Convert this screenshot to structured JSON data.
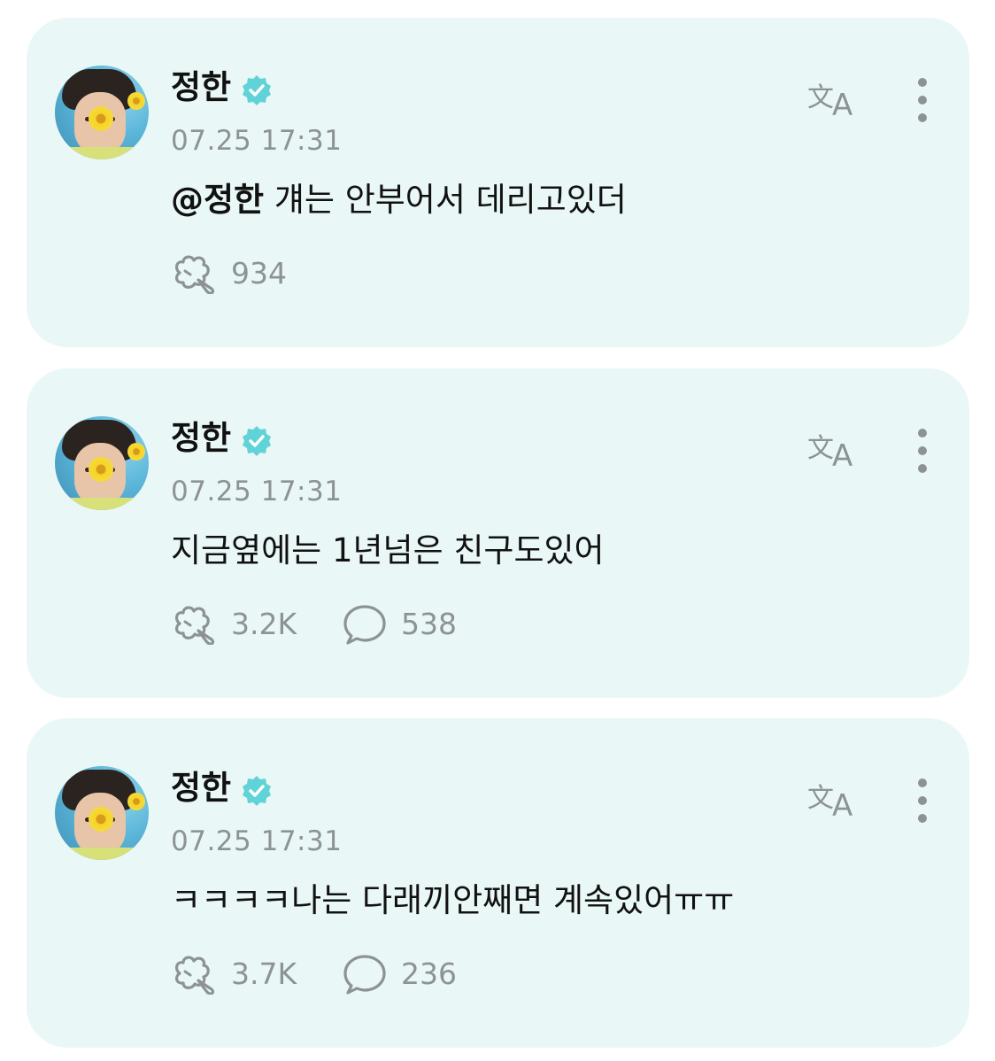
{
  "posts": [
    {
      "author": "정한",
      "timestamp": "07.25 17:31",
      "mention": "@정한",
      "text": " 걔는 안부어서 데리고있더",
      "likes": "934",
      "comments": ""
    },
    {
      "author": "정한",
      "timestamp": "07.25 17:31",
      "mention": "",
      "text": "지금옆에는 1년넘은 친구도있어",
      "likes": "3.2K",
      "comments": "538"
    },
    {
      "author": "정한",
      "timestamp": "07.25 17:31",
      "mention": "",
      "text": "ㅋㅋㅋㅋ나는 다래끼안째면 계속있어ㅠㅠ",
      "likes": "3.7K",
      "comments": "236"
    }
  ],
  "icons": {
    "verified": "verified-badge-icon",
    "translate": "translate-icon",
    "more": "more-vertical-icon",
    "like": "flower-like-icon",
    "comment": "comment-bubble-icon"
  },
  "colors": {
    "card_background": "#e9f8f6",
    "verified_badge": "#5fd3d8",
    "muted_text": "#8d9296",
    "icon_gray": "#8d9296"
  }
}
